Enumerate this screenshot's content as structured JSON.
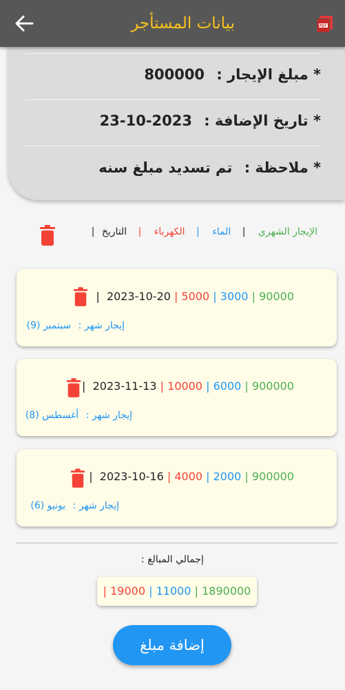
{
  "app_bar": {
    "title": "بيانات المستأجر",
    "back_icon": "arrow-left-icon",
    "pdf_icon": "pdf-icon"
  },
  "info": {
    "rent_label": "* مبلغ الإيجار :",
    "rent_value": "800000",
    "date_label": "* تاريخ الإضافة :",
    "date_value": "2023-10-23",
    "note_label": "* ملاحظة :",
    "note_value": "تم تسديد مبلغ سنه"
  },
  "legend": {
    "monthly_rent": "الإيجار الشهري",
    "water": "الماء",
    "electricity": "الكهرباء",
    "date": "التاريخ",
    "separator": "|"
  },
  "payments": [
    {
      "rent": "90000",
      "water": "3000",
      "electricity": "5000",
      "date": "2023-10-20",
      "month_label": "إيجار شهر :",
      "month": "سبتمبر (9)"
    },
    {
      "rent": "900000",
      "water": "6000",
      "electricity": "10000",
      "date": "2023-11-13",
      "month_label": "إيجار شهر :",
      "month": "أغسطس (8)"
    },
    {
      "rent": "900000",
      "water": "2000",
      "electricity": "4000",
      "date": "2023-10-16",
      "month_label": "إيجار شهر :",
      "month": "يونيو (6)"
    }
  ],
  "totals": {
    "label": "إجمالي المبالغ :",
    "rent": "1890000",
    "water": "11000",
    "electricity": "19000"
  },
  "add_button": "إضافة مبلغ",
  "colors": {
    "appbar": "#575757",
    "title": "#f7c21c",
    "green": "#4caf50",
    "blue": "#2196f3",
    "red": "#f44336",
    "card": "#fffce8"
  }
}
